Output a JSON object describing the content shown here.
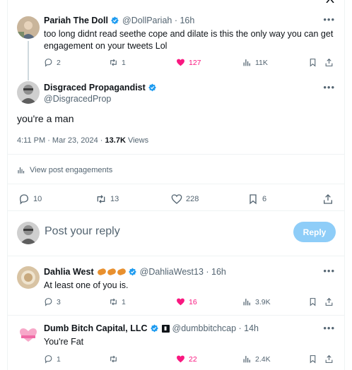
{
  "tweets": [
    {
      "name": "Pariah The Doll",
      "handle": "@DollPariah · 16h",
      "text": "too long didnt read seethe cope and dilate is this the only way you can get engagement on your tweets Lol",
      "replies": "2",
      "retweets": "1",
      "likes": "127",
      "views": "11K"
    }
  ],
  "main": {
    "name": "Disgraced Propagandist",
    "handle": "@DisgracedProp",
    "text": "you're a man",
    "timestamp": "4:11 PM · Mar 23, 2024 · ",
    "views_count": "13.7K",
    "views_label": " Views",
    "engagements_label": "View post engagements",
    "replies": "10",
    "retweets": "13",
    "likes": "228",
    "bookmarks": "6"
  },
  "composer": {
    "placeholder": "Post your reply",
    "button": "Reply"
  },
  "replies": [
    {
      "name": "Dahlia West",
      "handle": "@DahliaWest13 · 16h",
      "text": "At least one of you is.",
      "replies": "3",
      "retweets": "1",
      "likes": "16",
      "views": "3.9K"
    },
    {
      "name": "Dumb Bitch Capital, LLC",
      "handle": "@dumbbitchcap · 14h",
      "text": "You're Fat",
      "replies": "1",
      "retweets": "",
      "likes": "22",
      "views": "2.4K"
    }
  ],
  "icons": {
    "more": "more-icon",
    "verified": "verified-badge-icon",
    "reply": "reply-icon",
    "retweet": "retweet-icon",
    "like": "heart-icon",
    "views": "views-icon",
    "bookmark": "bookmark-icon",
    "share": "share-icon"
  },
  "colors": {
    "accent": "#1d9bf0",
    "like": "#f91880",
    "muted": "#536471",
    "reply_button": "#8ecdf8"
  }
}
